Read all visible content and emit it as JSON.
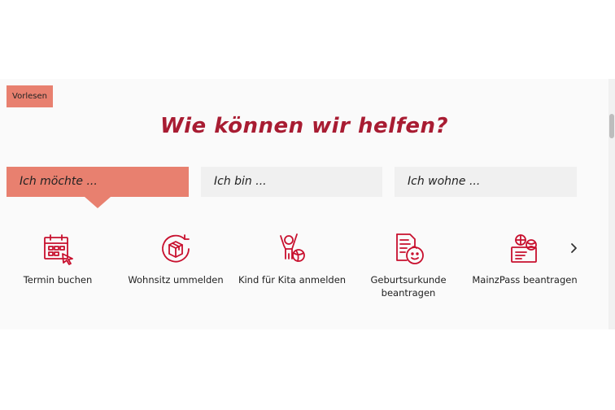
{
  "read_aloud": {
    "label": "Vorlesen"
  },
  "headline": "Wie können wir helfen?",
  "tabs": [
    {
      "label": "Ich möchte ...",
      "active": true
    },
    {
      "label": "Ich bin ...",
      "active": false
    },
    {
      "label": "Ich wohne ...",
      "active": false
    }
  ],
  "services": [
    {
      "label": "Termin buchen",
      "icon": "calendar-cursor-icon"
    },
    {
      "label": "Wohnsitz ummelden",
      "icon": "box-move-icon"
    },
    {
      "label": "Kind für Kita anmelden",
      "icon": "child-ball-icon"
    },
    {
      "label": "Geburtsurkunde\nbeantragen",
      "icon": "baby-document-icon"
    },
    {
      "label": "MainzPass beantragen",
      "icon": "pass-card-icon"
    }
  ],
  "colors": {
    "accent": "#e8806f",
    "headline": "#a81c32",
    "icon": "#c8102e",
    "tab_inactive": "#f0f0f0"
  },
  "next_icon": "chevron-right-icon"
}
